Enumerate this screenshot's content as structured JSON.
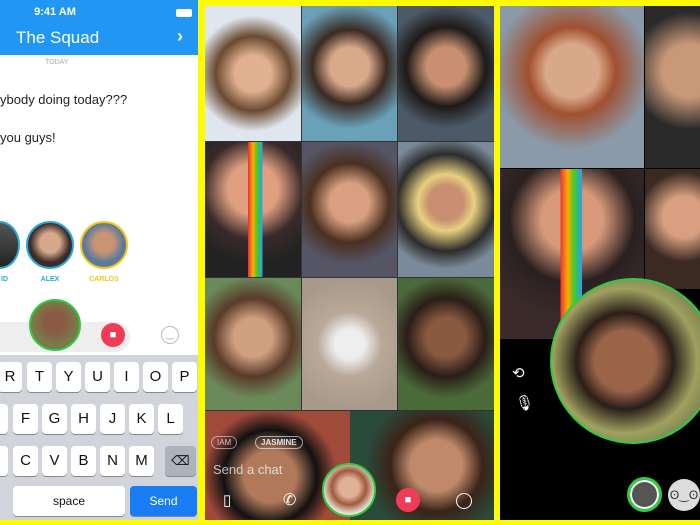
{
  "status": {
    "time": "9:41 AM"
  },
  "chat": {
    "title": "The Squad",
    "date_label": "TODAY",
    "messages": [
      "ybody doing today???",
      "you guys!"
    ],
    "participants": [
      {
        "name": "ID",
        "color": "#2aa9d8"
      },
      {
        "name": "ALEX",
        "color": "#2aa9d8"
      },
      {
        "name": "CARLOS",
        "color": "#f5c518"
      }
    ]
  },
  "keyboard": {
    "rows": [
      [
        "R",
        "T",
        "Y",
        "U",
        "I",
        "O",
        "P"
      ],
      [
        "F",
        "G",
        "H",
        "J",
        "K",
        "L"
      ],
      [
        "C",
        "V",
        "B",
        "N",
        "M"
      ]
    ],
    "space": "space",
    "send": "Send"
  },
  "group_call": {
    "chips": [
      "IAM",
      "JASMINE"
    ],
    "input_placeholder": "Send a chat"
  },
  "colors": {
    "snap_yellow": "#FFFC00",
    "header_blue": "#2196F3",
    "video_red": "#F23C57",
    "ring_green": "#2ECC40",
    "send_blue": "#1A7CF5"
  },
  "icons": [
    "battery-icon",
    "chevron-right-icon",
    "video-icon",
    "emoji-icon",
    "backspace-icon",
    "cards-icon",
    "phone-icon",
    "flip-camera-icon",
    "microphone-icon",
    "capture-button",
    "lens-icon"
  ]
}
